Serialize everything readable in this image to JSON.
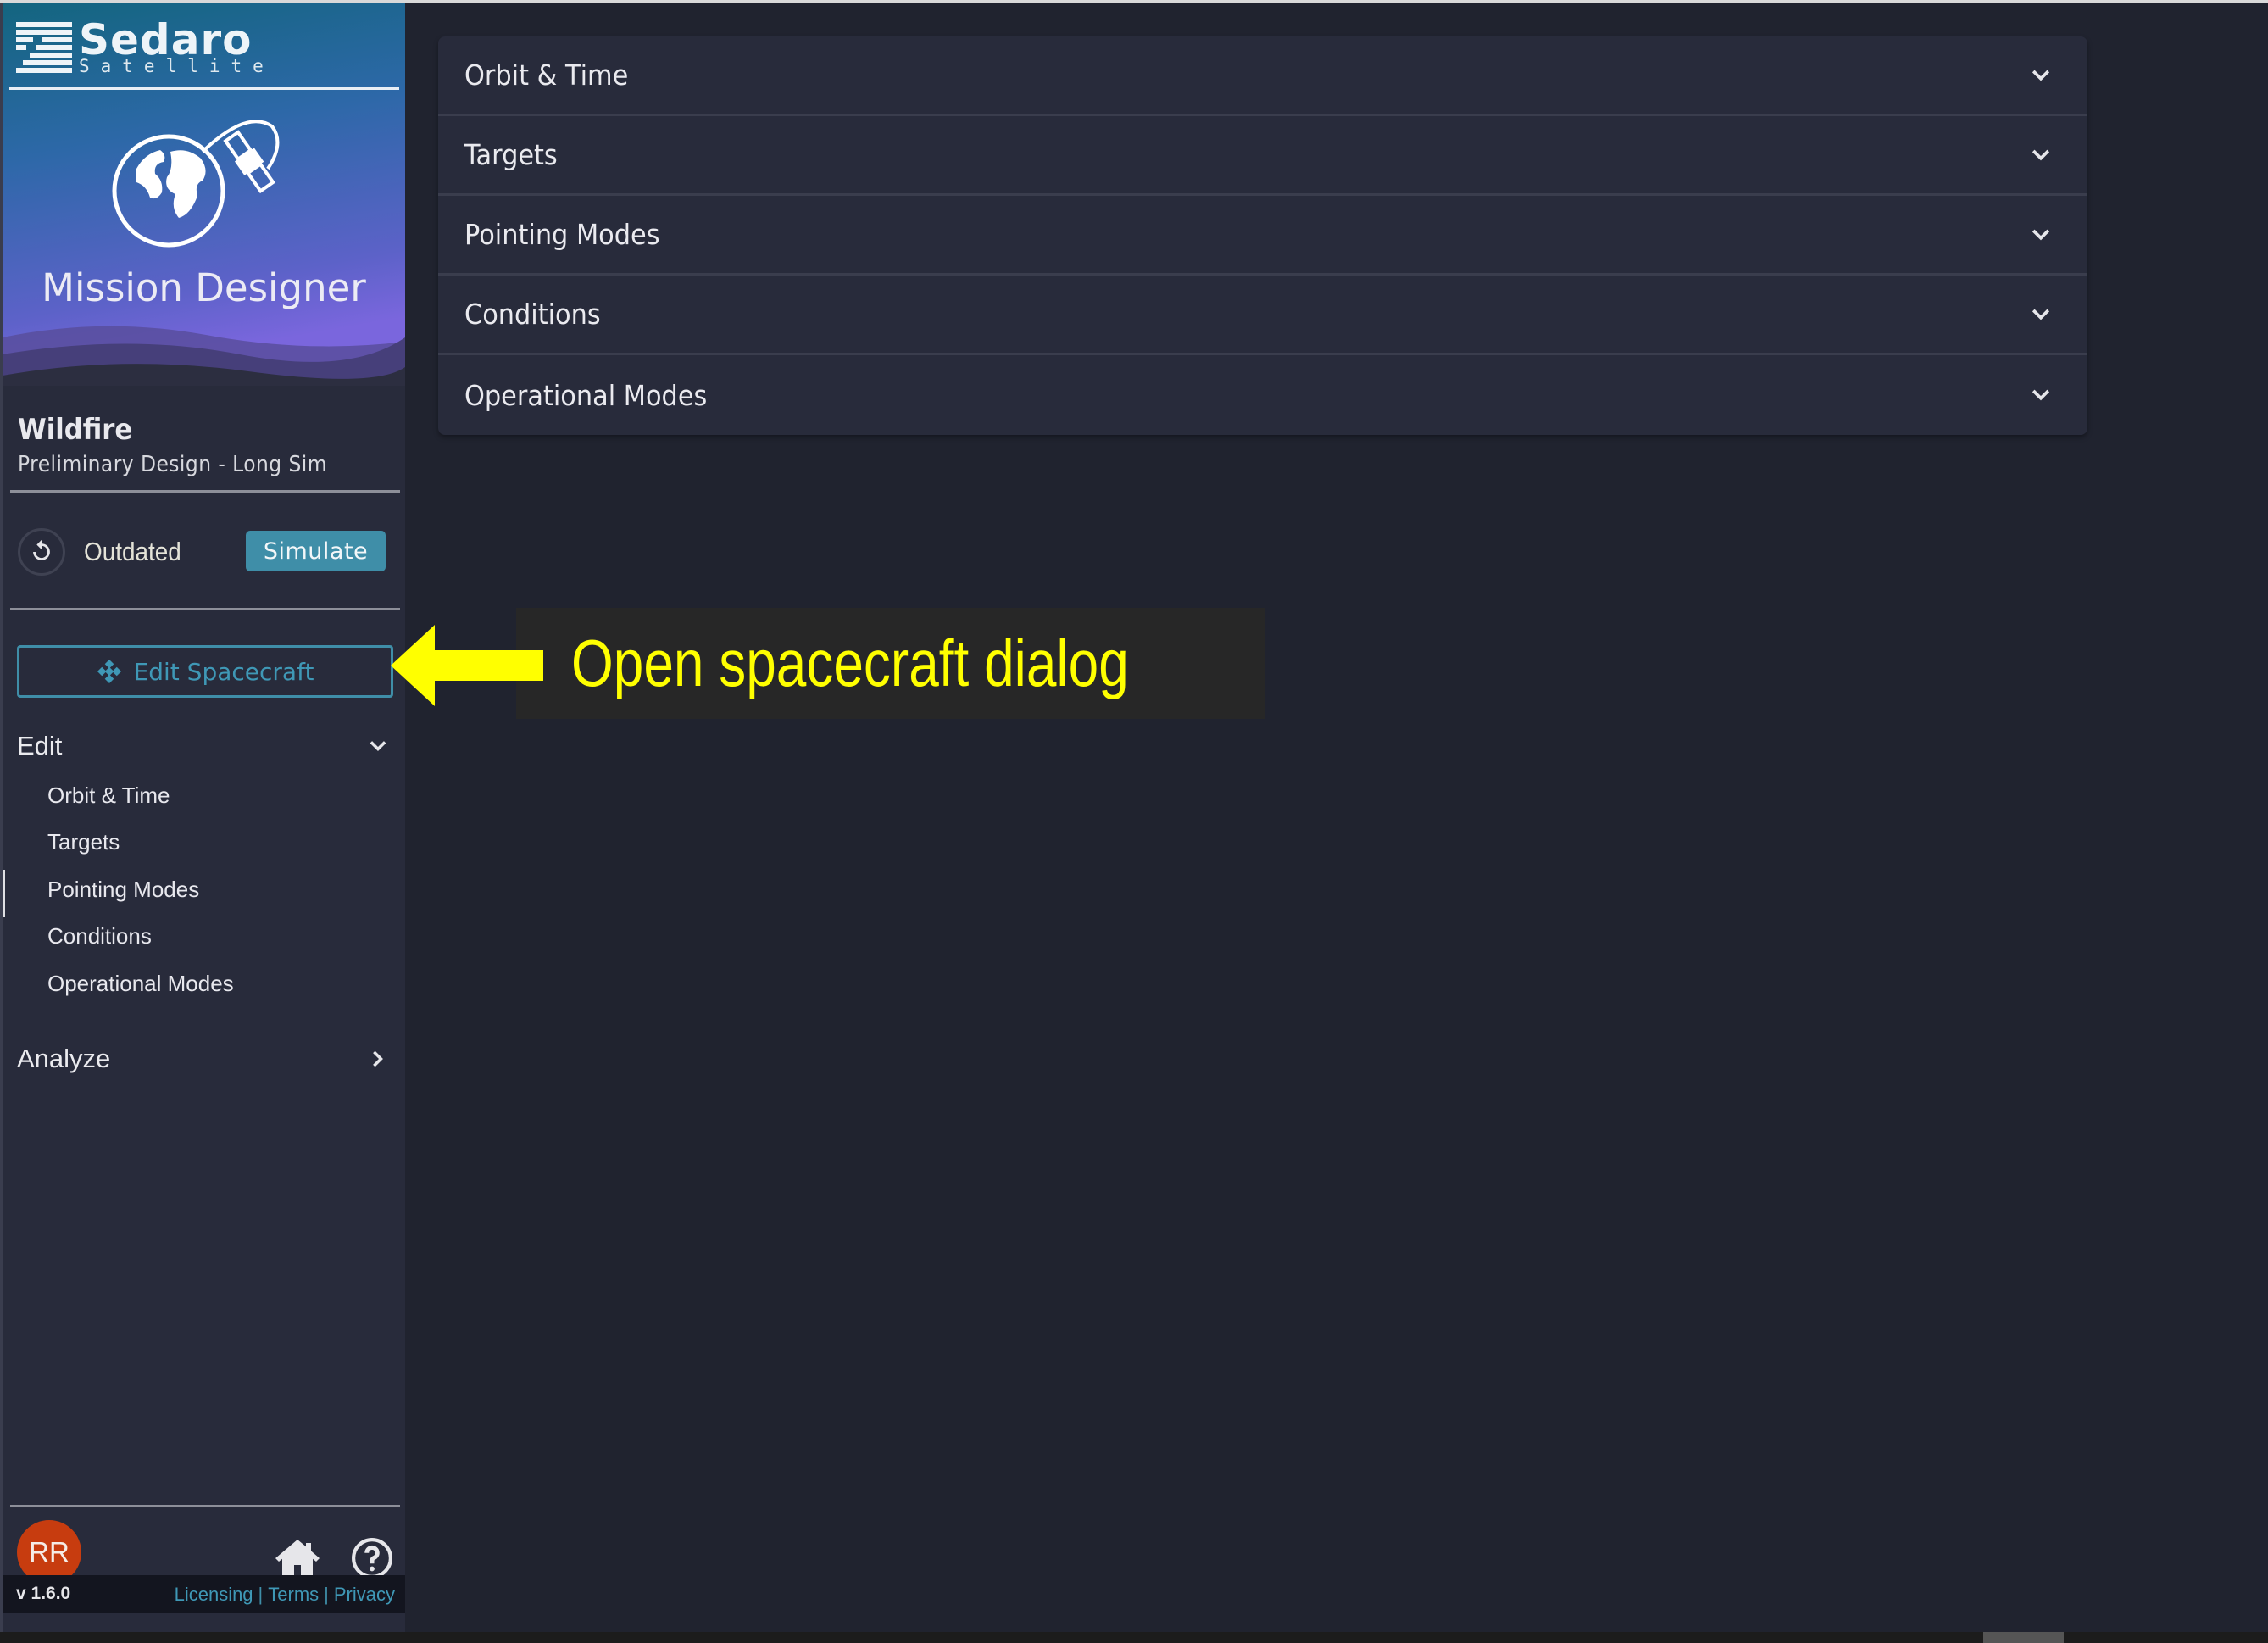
{
  "brand": {
    "company": "Sedaro",
    "company_sub": "Satellite",
    "app_name": "Mission Designer"
  },
  "project": {
    "name": "Wildfire",
    "subtitle": "Preliminary Design - Long Sim"
  },
  "status": {
    "text": "Outdated",
    "simulate_label": "Simulate"
  },
  "edit_spacecraft_label": "Edit Spacecraft",
  "nav": {
    "edit": {
      "label": "Edit",
      "items": [
        {
          "label": "Orbit & Time"
        },
        {
          "label": "Targets"
        },
        {
          "label": "Pointing Modes"
        },
        {
          "label": "Conditions"
        },
        {
          "label": "Operational Modes"
        }
      ]
    },
    "analyze": {
      "label": "Analyze"
    }
  },
  "user": {
    "initials": "RR"
  },
  "footer": {
    "version": "v 1.6.0",
    "links": [
      "Licensing",
      "Terms",
      "Privacy"
    ]
  },
  "accordion": [
    {
      "label": "Orbit & Time"
    },
    {
      "label": "Targets"
    },
    {
      "label": "Pointing Modes"
    },
    {
      "label": "Conditions"
    },
    {
      "label": "Operational Modes"
    }
  ],
  "annotation": {
    "text": "Open spacecraft dialog"
  },
  "colors": {
    "accent": "#3f8ea8",
    "avatar": "#c73c0f",
    "annotation": "#ffff00"
  }
}
